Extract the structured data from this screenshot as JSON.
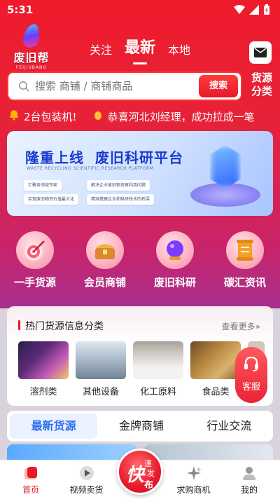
{
  "status": {
    "time": "5:31"
  },
  "brand": {
    "name": "废旧帮",
    "sub": "FEIJIUBANG"
  },
  "top_tabs": [
    {
      "label": "关注"
    },
    {
      "label": "最新"
    },
    {
      "label": "本地"
    }
  ],
  "search": {
    "placeholder": "搜索 商铺 / 商铺商品",
    "button": "搜索"
  },
  "category_link": {
    "line1": "货源",
    "line2": "分类"
  },
  "ticker": {
    "item1": "2台包装机!",
    "item2": "恭喜河北刘经理，成功拉成一笔"
  },
  "banner": {
    "title_a": "隆重上线",
    "title_b": "废旧科研平台",
    "subtitle": "WASTE RECYCLING SCIENTIFIC RESEARCH PLATFORM",
    "pills": [
      "汇聚各领域专家",
      "解决企业废旧物资再利用问题",
      "实现废旧物资价值最大化",
      "精准搭建企业和科研技术的桥梁"
    ]
  },
  "quick_entries": [
    {
      "label": "一手货源",
      "icon": "target-icon"
    },
    {
      "label": "会员商铺",
      "icon": "treasure-chest-icon"
    },
    {
      "label": "废旧科研",
      "icon": "crystal-ball-icon"
    },
    {
      "label": "碳汇资讯",
      "icon": "scroll-icon"
    }
  ],
  "hot": {
    "title": "热门货源信息分类",
    "more": "查看更多»",
    "items": [
      {
        "label": "溶剂类"
      },
      {
        "label": "其他设备"
      },
      {
        "label": "化工原料"
      },
      {
        "label": "食品类"
      }
    ]
  },
  "customer_service": {
    "label": "客服"
  },
  "feed_tabs": [
    {
      "label": "最新货源"
    },
    {
      "label": "金牌商铺"
    },
    {
      "label": "行业交流"
    }
  ],
  "fab": {
    "big": "快",
    "s1": "速",
    "s2": "发",
    "s3": "布"
  },
  "bottom_nav": [
    {
      "label": "首页"
    },
    {
      "label": "视频卖货"
    },
    {
      "label": "求购商机"
    },
    {
      "label": "我的"
    }
  ],
  "colors": {
    "primary": "#e8192b",
    "accent_blue": "#2c6ff0",
    "banner_title": "#1a3bd1"
  }
}
